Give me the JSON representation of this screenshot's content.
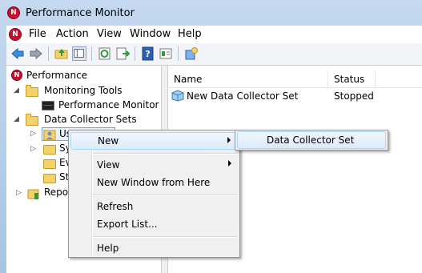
{
  "window": {
    "title": "Performance Monitor"
  },
  "menu": [
    "File",
    "Action",
    "View",
    "Window",
    "Help"
  ],
  "toolbar": {
    "icons": [
      "back-arrow-icon",
      "forward-arrow-icon",
      "up-folder-icon",
      "show-hide-tree-icon",
      "refresh-icon",
      "export-list-icon",
      "help-icon",
      "properties-icon",
      "new-icon"
    ]
  },
  "tree": {
    "root": "Performance",
    "monitoring_tools": "Monitoring Tools",
    "performance_monitor": "Performance Monitor",
    "data_collector_sets": "Data Collector Sets",
    "user_defined": "Us",
    "system": "Sy",
    "event_trace": "Ev",
    "startup": "St",
    "reports": "Repor"
  },
  "list": {
    "columns": [
      "Name",
      "Status"
    ],
    "rows": [
      {
        "name": "New Data Collector Set",
        "status": "Stopped"
      }
    ]
  },
  "context_menu": {
    "new": "New",
    "view": "View",
    "new_window": "New Window from Here",
    "refresh": "Refresh",
    "export_list": "Export List...",
    "help": "Help"
  },
  "submenu": {
    "data_collector_set": "Data Collector Set"
  },
  "colors": {
    "highlight": "#dcebfc",
    "title_bar": "#c4d9ef"
  }
}
